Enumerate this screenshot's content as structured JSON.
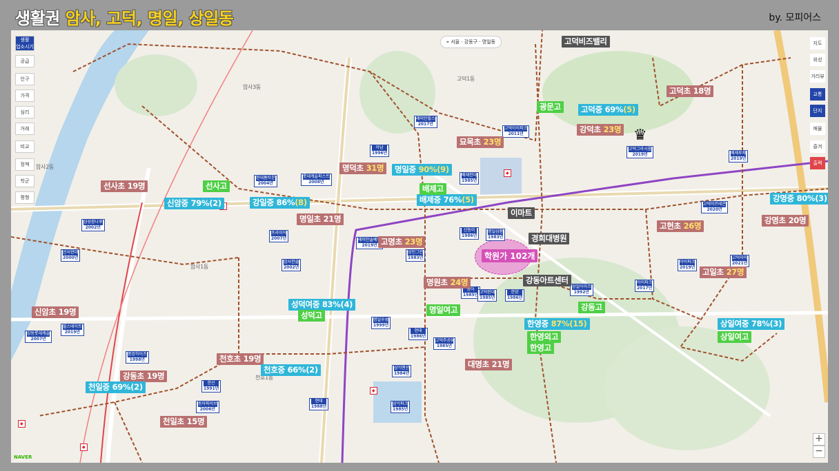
{
  "header": {
    "title_prefix": "생활권 ",
    "title_highlight": "암사, 고덕, 명일, 상일동",
    "byline": "by. 모피어스"
  },
  "colors": {
    "elementary": "#b97070",
    "middle": "#2fb6d9",
    "high": "#4fcf45",
    "landmark": "#545454",
    "highlight": "#ffe26a",
    "academy": "#e468c8"
  },
  "map_controls": {
    "left_buttons": [
      "생활\n업소시기",
      "공급",
      "인구",
      "가격",
      "심리",
      "거래",
      "비교",
      "정책",
      "학군",
      "평형"
    ],
    "right_buttons": [
      "지도",
      "위성",
      "거리뷰",
      "교통",
      "단지",
      "매물",
      "즐겨",
      "출력"
    ],
    "top_nav": [
      "서울",
      "강동구",
      "명일동"
    ],
    "zoom_in": "+",
    "zoom_out": "−",
    "logo": "NAVER"
  },
  "elementary_schools": [
    {
      "name": "선사초",
      "count": "19명"
    },
    {
      "name": "명덕초",
      "count": "31명"
    },
    {
      "name": "묘목초",
      "count": "23명"
    },
    {
      "name": "강덕초",
      "count": "23명"
    },
    {
      "name": "고덕초",
      "count": "18명"
    },
    {
      "name": "명일초",
      "count": "21명"
    },
    {
      "name": "고명초",
      "count": "23명"
    },
    {
      "name": "고현초",
      "count": "26명"
    },
    {
      "name": "강명초",
      "count": "20명"
    },
    {
      "name": "명원초",
      "count": "24명"
    },
    {
      "name": "고일초",
      "count": "27명"
    },
    {
      "name": "신암초",
      "count": "19명"
    },
    {
      "name": "천호초",
      "count": "19명"
    },
    {
      "name": "강동초",
      "count": "19명"
    },
    {
      "name": "대명초",
      "count": "21명"
    },
    {
      "name": "천일초",
      "count": "15명"
    }
  ],
  "middle_schools": [
    {
      "name": "고덕중",
      "pct": "69%",
      "rank": "(5)"
    },
    {
      "name": "명일중",
      "pct": "90%",
      "rank": "(9)"
    },
    {
      "name": "배제중",
      "pct": "76%",
      "rank": "(5)"
    },
    {
      "name": "신암중",
      "pct": "79%",
      "rank": "(2)"
    },
    {
      "name": "강일중",
      "pct": "86%",
      "rank": "(8)"
    },
    {
      "name": "강명중",
      "pct": "80%",
      "rank": "(3)"
    },
    {
      "name": "성덕여중",
      "pct": "83%",
      "rank": "(4)"
    },
    {
      "name": "한영중",
      "pct": "87%",
      "rank": "(15)"
    },
    {
      "name": "상일여중",
      "pct": "78%",
      "rank": "(3)"
    },
    {
      "name": "천호중",
      "pct": "66%",
      "rank": "(2)"
    },
    {
      "name": "천일중",
      "pct": "69%",
      "rank": "(2)"
    }
  ],
  "high_schools": [
    "광문고",
    "선사고",
    "배제고",
    "명일여고",
    "성덕고",
    "강동고",
    "한영외고",
    "한영고",
    "상일여고"
  ],
  "landmarks": [
    "고덕비즈밸리",
    "이마트",
    "경희대병원",
    "강동아트센터"
  ],
  "academy": {
    "label": "학원가 102개"
  },
  "district_labels": [
    "암사3동",
    "암사2동",
    "고덕1동",
    "천호1동",
    "암사1동"
  ],
  "apartments": [
    {
      "name": "현대홈타운",
      "year": "2004년"
    },
    {
      "name": "롯데캐슬퍼스트",
      "year": "2008년"
    },
    {
      "name": "래미안힐스",
      "year": "2017년"
    },
    {
      "name": "고덕아이파크",
      "year": "2011년"
    },
    {
      "name": "아남",
      "year": "1996년"
    },
    {
      "name": "배재현대",
      "year": "1985년"
    },
    {
      "name": "고덕그라시움",
      "year": "2019년"
    },
    {
      "name": "선사현대",
      "year": "2000년"
    },
    {
      "name": "삼성광나루",
      "year": "2002년"
    },
    {
      "name": "프라이어",
      "year": "2007년"
    },
    {
      "name": "래미안솔베뉴",
      "year": "2019년"
    },
    {
      "name": "신동아",
      "year": "1986년"
    },
    {
      "name": "명일삼환",
      "year": "1983년"
    },
    {
      "name": "상인그린",
      "year": "1983년"
    },
    {
      "name": "암사한솔",
      "year": "2002년"
    },
    {
      "name": "고덕아르테온",
      "year": "2020년"
    },
    {
      "name": "아이파크",
      "year": "2019년"
    },
    {
      "name": "고덕자이",
      "year": "2021년"
    },
    {
      "name": "동아",
      "year": "1985년"
    },
    {
      "name": "고덕현대",
      "year": "1985년"
    },
    {
      "name": "한양",
      "year": "1986년"
    },
    {
      "name": "힐스테이트",
      "year": "2019년"
    },
    {
      "name": "현대",
      "year": "1986년"
    },
    {
      "name": "강동롯데캐슬",
      "year": "2007년"
    },
    {
      "name": "중앙하이츠",
      "year": "1998년"
    },
    {
      "name": "한신",
      "year": "1991년"
    },
    {
      "name": "동아파이브",
      "year": "2006년"
    },
    {
      "name": "현대",
      "year": "1988년"
    },
    {
      "name": "고덕주공9",
      "year": "1985년"
    },
    {
      "name": "삼익파크",
      "year": "1985년"
    },
    {
      "name": "삼익맨션",
      "year": "1984년"
    },
    {
      "name": "배재루체",
      "year": "2019년"
    },
    {
      "name": "상일아이즈",
      "year": "1992년"
    },
    {
      "name": "아이파크",
      "year": "2017년"
    },
    {
      "name": "명일우성",
      "year": "1999년"
    }
  ]
}
